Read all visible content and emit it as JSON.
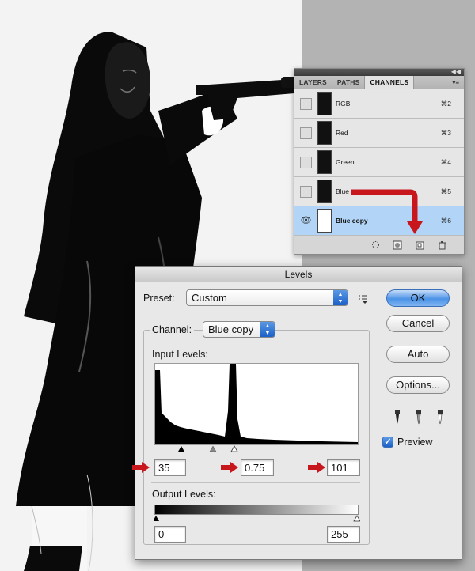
{
  "channels_panel": {
    "tabs": [
      {
        "label": "LAYERS"
      },
      {
        "label": "PATHS"
      },
      {
        "label": "CHANNELS"
      }
    ],
    "channels": [
      {
        "name": "RGB",
        "shortcut": "⌘2",
        "visible": false,
        "selected": false
      },
      {
        "name": "Red",
        "shortcut": "⌘3",
        "visible": false,
        "selected": false
      },
      {
        "name": "Green",
        "shortcut": "⌘4",
        "visible": false,
        "selected": false
      },
      {
        "name": "Blue",
        "shortcut": "⌘5",
        "visible": false,
        "selected": false
      },
      {
        "name": "Blue copy",
        "shortcut": "⌘6",
        "visible": true,
        "selected": true
      }
    ],
    "footer_icons": [
      "load-selection-icon",
      "save-selection-icon",
      "new-channel-icon",
      "trash-icon"
    ]
  },
  "levels_dialog": {
    "title": "Levels",
    "preset_label": "Preset:",
    "preset_value": "Custom",
    "channel_label": "Channel:",
    "channel_value": "Blue copy",
    "input_levels_label": "Input Levels:",
    "input_black": "35",
    "input_gamma": "0.75",
    "input_white": "101",
    "output_levels_label": "Output Levels:",
    "output_black": "0",
    "output_white": "255",
    "buttons": {
      "ok": "OK",
      "cancel": "Cancel",
      "auto": "Auto",
      "options": "Options..."
    },
    "preview_label": "Preview",
    "preview_checked": true
  },
  "colors": {
    "highlight": "#b2d5f7",
    "red_arrow": "#c8161d",
    "accent": "#3b86e3"
  }
}
